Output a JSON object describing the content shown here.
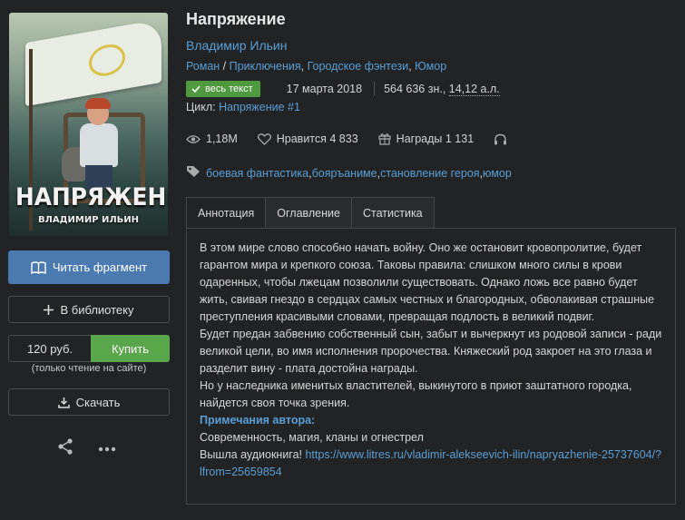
{
  "cover": {
    "title": "НАПРЯЖЕНИЕ",
    "author": "ВЛАДИМИР ИЛЬИН"
  },
  "actions": {
    "read_label": "Читать фрагмент",
    "library_label": "В библиотеку",
    "price": "120 руб.",
    "buy_label": "Купить",
    "buy_note": "(только чтение на сайте)",
    "download_label": "Скачать"
  },
  "book": {
    "title": "Напряжение",
    "author": "Владимир Ильин",
    "genres": [
      "Роман",
      "Приключения",
      "Городское фэнтези",
      "Юмор"
    ],
    "genre_sep_slash": " / ",
    "genre_sep_comma": ", ",
    "badge": "весь текст",
    "date": "17 марта 2018",
    "size_chars": "564 636 зн., ",
    "size_al": "14,12 а.л.",
    "cycle_label": "Цикл: ",
    "cycle_value": "Напряжение #1"
  },
  "stats": {
    "views": "1,18M",
    "likes": "Нравится 4 833",
    "awards": "Награды 1 131"
  },
  "tags": [
    "боевая фантастика",
    "бояръаниме",
    "становление героя",
    "юмор"
  ],
  "tabs": [
    "Аннотация",
    "Оглавление",
    "Статистика"
  ],
  "annotation": {
    "paragraphs": [
      "В этом мире слово способно начать войну. Оно же остановит кровопролитие, будет гарантом мира и крепкого союза. Таковы правила: слишком много силы в крови одаренных, чтобы лжецам позволили существовать. Однако ложь все равно будет жить, свивая гнездо в сердцах самых честных и благородных, обволакивая страшные преступления красивыми словами, превращая подлость в великий подвиг.",
      "Будет предан забвению собственный сын, забыт и вычеркнут из родовой записи - ради великой цели, во имя исполнения пророчества. Княжеский род закроет на это глаза и разделит вину - плата достойна награды.",
      "Но у наследника именитых властителей, выкинутого в приют заштатного городка, найдется своя точка зрения."
    ],
    "notes_title": "Примечания автора:",
    "notes_line1": "Современность, магия, кланы и огнестрел",
    "notes_line2_text": "Вышла аудиокнига! ",
    "notes_link": "https://www.litres.ru/vladimir-alekseevich-ilin/napryazhenie-25737604/?lfrom=25659854"
  },
  "colors": {
    "background": "#222324",
    "link": "#5a9fd6",
    "read_button": "#4a7ab0",
    "buy_button": "#5aa64a",
    "badge": "#4f9a3e"
  },
  "icons": [
    "book-icon",
    "plus-icon",
    "download-icon",
    "share-icon",
    "more-icon",
    "check-icon",
    "eye-icon",
    "heart-icon",
    "gift-icon",
    "headphones-icon",
    "tag-icon"
  ]
}
